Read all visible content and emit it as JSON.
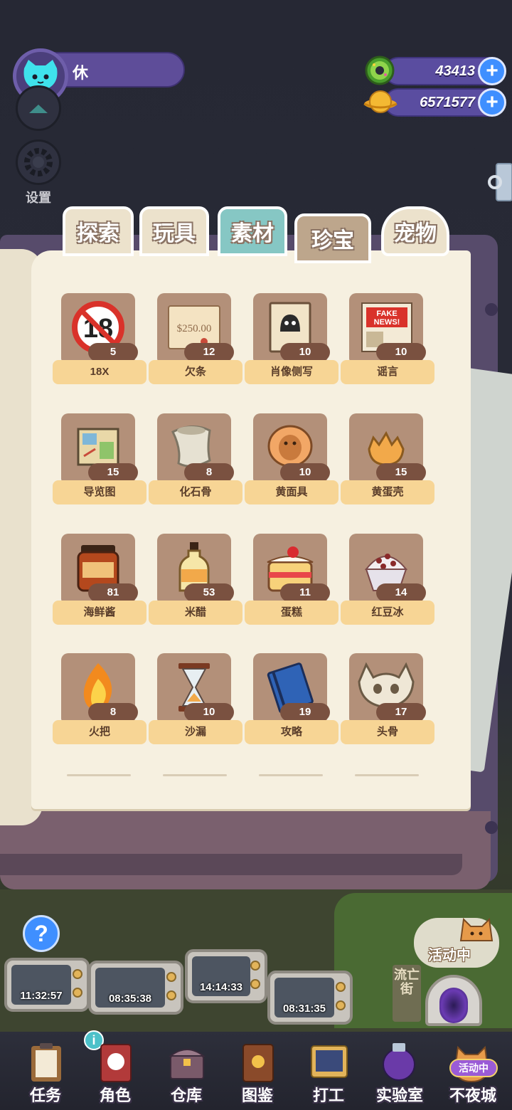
{
  "player": {
    "name": "休"
  },
  "settings": {
    "label": "设置"
  },
  "currencies": [
    {
      "icon": "green-donut-icon",
      "value": "43413"
    },
    {
      "icon": "gold-planet-coin-icon",
      "value": "6571577"
    }
  ],
  "tabs": [
    {
      "label": "探索",
      "active": false
    },
    {
      "label": "玩具",
      "active": false
    },
    {
      "label": "素材",
      "active": false
    },
    {
      "label": "珍宝",
      "active": true
    },
    {
      "label": "宠物",
      "active": false
    }
  ],
  "items": [
    {
      "name": "18X",
      "count": "5",
      "icon": "no-18-sign-icon"
    },
    {
      "name": "欠条",
      "count": "12",
      "icon": "iou-note-icon"
    },
    {
      "name": "肖像侧写",
      "count": "10",
      "icon": "portrait-sketch-icon"
    },
    {
      "name": "谣言",
      "count": "10",
      "icon": "fake-news-icon"
    },
    {
      "name": "导览图",
      "count": "15",
      "icon": "guide-map-icon"
    },
    {
      "name": "化石骨",
      "count": "8",
      "icon": "fossil-bone-icon"
    },
    {
      "name": "黄面具",
      "count": "10",
      "icon": "yellow-mask-icon"
    },
    {
      "name": "黄蛋壳",
      "count": "15",
      "icon": "yellow-eggshell-icon"
    },
    {
      "name": "海鲜酱",
      "count": "81",
      "icon": "seafood-sauce-jar-icon"
    },
    {
      "name": "米醋",
      "count": "53",
      "icon": "rice-vinegar-bottle-icon"
    },
    {
      "name": "蛋糕",
      "count": "11",
      "icon": "cake-icon"
    },
    {
      "name": "红豆冰",
      "count": "14",
      "icon": "red-bean-ice-icon"
    },
    {
      "name": "火把",
      "count": "8",
      "icon": "torch-fire-icon"
    },
    {
      "name": "沙漏",
      "count": "10",
      "icon": "hourglass-icon"
    },
    {
      "name": "攻略",
      "count": "19",
      "icon": "guide-book-icon"
    },
    {
      "name": "头骨",
      "count": "17",
      "icon": "skull-icon"
    }
  ],
  "item_art_text": {
    "iou_amount": "$250.00",
    "fake_news_line1": "FAKE",
    "fake_news_line2": "NEWS!",
    "no18_number": "18"
  },
  "timers": [
    "11:32:57",
    "08:35:38",
    "14:14:33",
    "08:31:35"
  ],
  "street_sign": "流亡街",
  "event_bubble": "活动中",
  "nav": [
    {
      "label": "任务",
      "icon": "clipboard-icon"
    },
    {
      "label": "角色",
      "icon": "character-card-icon"
    },
    {
      "label": "仓库",
      "icon": "treasure-chest-icon"
    },
    {
      "label": "图鉴",
      "icon": "encyclopedia-book-icon"
    },
    {
      "label": "打工",
      "icon": "work-monitor-icon"
    },
    {
      "label": "实验室",
      "icon": "lab-flask-icon"
    },
    {
      "label": "不夜城",
      "icon": "night-city-cat-icon",
      "badge": "活动中"
    }
  ],
  "colors": {
    "page": "#f6f0e0",
    "card": "#b39079",
    "label": "#f7d595",
    "count_pill": "#7a5140",
    "accent_blue": "#3f8fff"
  }
}
